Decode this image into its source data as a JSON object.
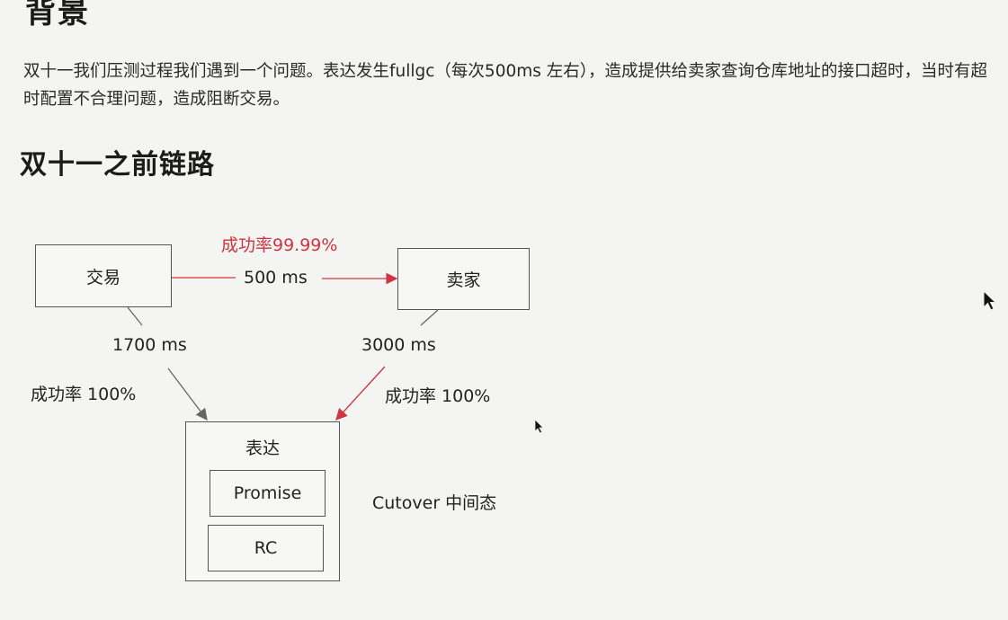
{
  "heading": "背景",
  "paragraph": "双十一我们压测过程我们遇到一个问题。表达发生fullgc（每次500ms 左右），造成提供给卖家查询仓库地址的接口超时，当时有超时配置不合理问题，造成阻断交易。",
  "section_title": "双十一之前链路",
  "diagram": {
    "nodes": {
      "trade": "交易",
      "seller": "卖家",
      "expression": "表达",
      "promise": "Promise",
      "rc": "RC"
    },
    "edges": {
      "trade_to_seller": {
        "latency": "500 ms",
        "success": "成功率99.99%"
      },
      "trade_to_expression": {
        "latency": "1700 ms",
        "success": "成功率 100%"
      },
      "seller_to_expression": {
        "latency": "3000 ms",
        "success": "成功率 100%"
      }
    },
    "note": "Cutover 中间态",
    "colors": {
      "accent": "#d0343f",
      "line": "#555555"
    }
  }
}
